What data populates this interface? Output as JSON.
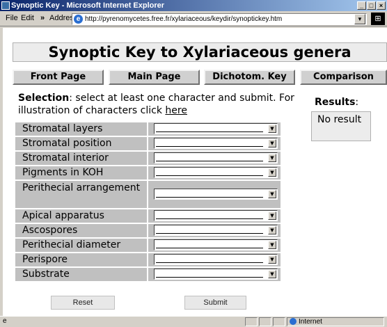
{
  "window": {
    "title": "Synoptic Key - Microsoft Internet Explorer"
  },
  "toolbar": {
    "menu": [
      "File",
      "Edit"
    ],
    "chevron": "»",
    "address_label": "Address",
    "address_url": "http://pyrenomycetes.free.fr/xylariaceous/keydir/synoptickey.htm"
  },
  "page": {
    "title": "Synoptic Key to Xylariaceous genera",
    "nav": [
      "Front Page",
      "Main Page",
      "Dichotom. Key",
      "Comparison"
    ],
    "selection_bold": "Selection",
    "selection_text": ": select at least one character and submit. For illustration of characters click ",
    "selection_link": "here",
    "results_label": "Results",
    "results_colon": ":",
    "results_value": "No result",
    "characters": [
      "Stromatal layers",
      "Stromatal position",
      "Stromatal interior",
      "Pigments in KOH",
      "Perithecial arrangement",
      "Apical apparatus",
      "Ascospores",
      "Perithecial diameter",
      "Perispore",
      "Substrate"
    ],
    "reset_label": "Reset",
    "submit_label": "Submit"
  },
  "status": {
    "zone": "Internet"
  }
}
